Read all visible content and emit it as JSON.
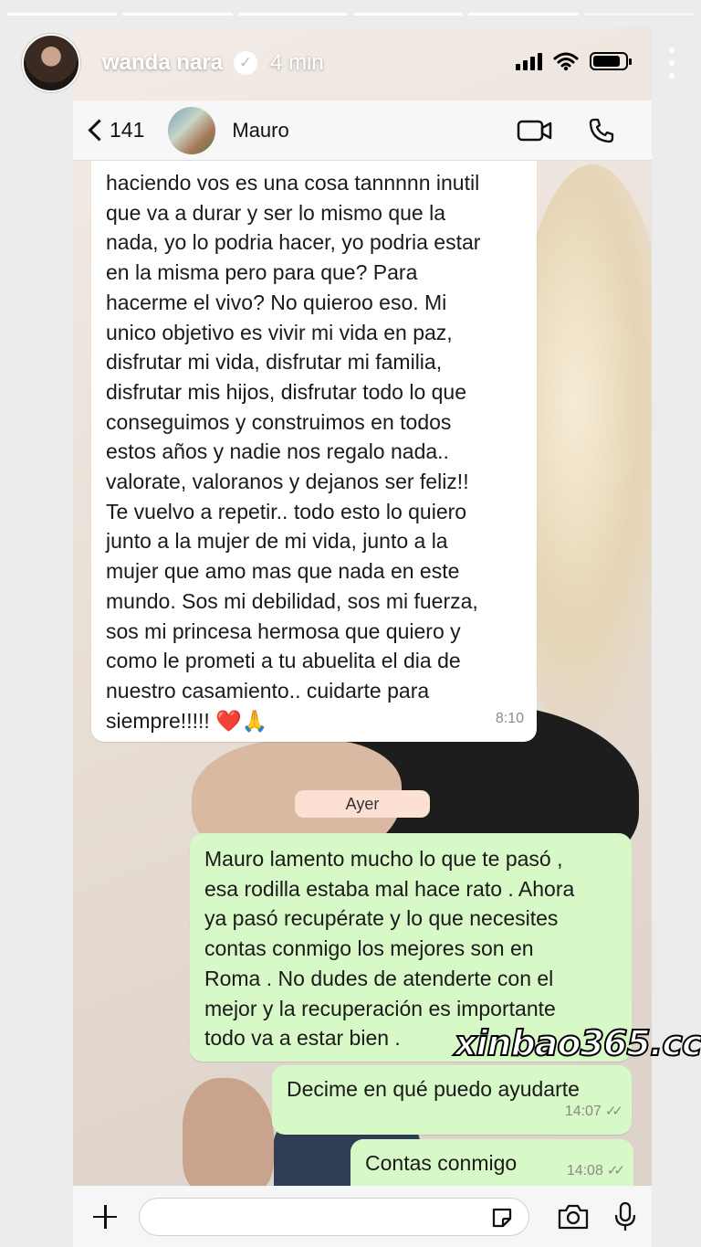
{
  "story": {
    "username": "wanda nara",
    "verified_mark": "✓",
    "time_ago": "4 min",
    "progress_segments": 6,
    "progress_done": 5
  },
  "status_bar": {
    "icons": [
      "signal-icon",
      "wifi-icon",
      "battery-icon"
    ]
  },
  "chat": {
    "back_count": "141",
    "contact_name": "Mauro",
    "actions": [
      "video-call-icon",
      "phone-icon"
    ]
  },
  "messages": [
    {
      "direction": "in",
      "lines": [
        "haciendo vos es una cosa tannnnn inutil",
        "que va a durar y ser lo mismo que la",
        "nada, yo lo podria hacer, yo podria estar",
        "en la misma pero para que? Para",
        "hacerme el vivo? No quieroo eso. Mi",
        "unico objetivo es vivir mi vida en paz,",
        "disfrutar mi vida, disfrutar mi familia,",
        "disfrutar mis hijos, disfrutar todo lo que",
        "conseguimos y construimos en todos",
        "estos años y nadie nos regalo nada..",
        "valorate, valoranos y dejanos ser feliz!!",
        "Te vuelvo a repetir.. todo esto lo quiero",
        "junto a la mujer de mi vida, junto a la",
        "mujer que amo mas que nada en este",
        "mundo. Sos mi debilidad, sos mi fuerza,",
        "sos mi princesa hermosa que quiero y",
        "como le prometi a tu abuelita el dia de",
        "nuestro casamiento.. cuidarte para",
        "siempre!!!!! ❤️🙏"
      ],
      "time": "8:10"
    },
    {
      "direction": "out",
      "lines": [
        "Mauro lamento mucho lo que te pasó ,",
        "esa rodilla estaba mal hace rato . Ahora",
        "ya pasó recupérate y lo que necesites",
        "contas conmigo los mejores son en",
        "Roma . No dudes de atenderte con el",
        "mejor y la recuperación es importante",
        "todo va a estar bien ."
      ],
      "time": ""
    },
    {
      "direction": "out",
      "lines": [
        "Decime en qué puedo ayudarte"
      ],
      "time": "14:07"
    },
    {
      "direction": "out",
      "lines": [
        "Contas conmigo"
      ],
      "time": "14:08"
    }
  ],
  "date_separator": "Ayer",
  "watermark": "xinbao365.cc",
  "composer": {
    "icons": [
      "plus-icon",
      "sticker-icon",
      "camera-icon",
      "microphone-icon"
    ]
  }
}
